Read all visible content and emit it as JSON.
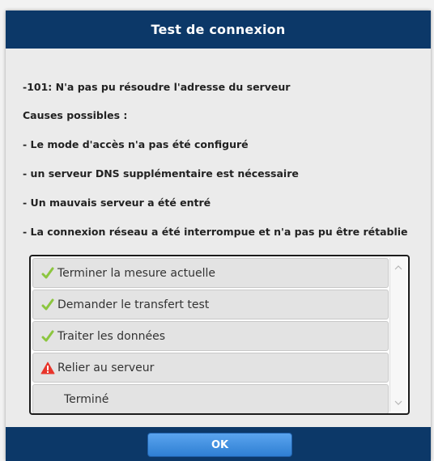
{
  "dialog": {
    "title": "Test de connexion"
  },
  "message": {
    "error": "-101: N'a pas pu résoudre l'adresse du serveur",
    "causes_heading": "Causes possibles :",
    "causes": [
      "- Le mode d'accès n'a pas été configuré",
      "- un serveur DNS supplémentaire est nécessaire",
      "- Un mauvais serveur a été entré",
      "- La connexion réseau a été interrompue et n'a pas pu être rétablie"
    ]
  },
  "steps": [
    {
      "label": "Terminer la mesure actuelle",
      "status": "done",
      "icon": "checkmark-icon"
    },
    {
      "label": "Demander le transfert test",
      "status": "done",
      "icon": "checkmark-icon"
    },
    {
      "label": "Traiter les données",
      "status": "done",
      "icon": "checkmark-icon"
    },
    {
      "label": "Relier au serveur",
      "status": "error",
      "icon": "warning-icon"
    },
    {
      "label": "Terminé",
      "status": "pending",
      "icon": ""
    }
  ],
  "colors": {
    "header_bg": "#0c3868",
    "success": "#8cc63f",
    "error": "#e8352b",
    "ok_button": "#3b8ee0"
  },
  "footer": {
    "ok_label": "OK"
  }
}
